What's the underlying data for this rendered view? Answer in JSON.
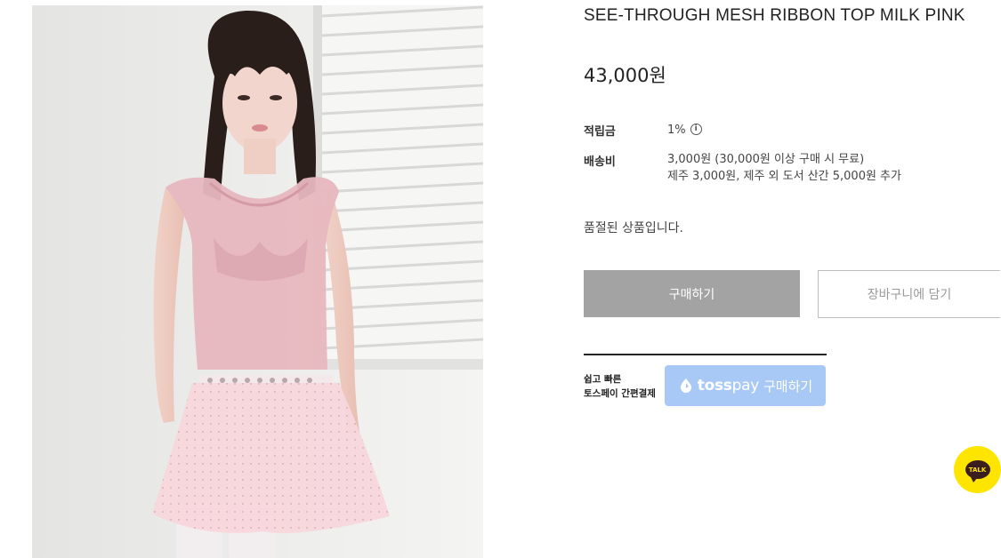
{
  "product": {
    "title": "SEE-THROUGH MESH RIBBON TOP MILK PINK",
    "price": "43,000원",
    "image_alt": "model wearing pink mesh top and tulle skirt"
  },
  "info": {
    "points_label": "적립금",
    "points_value": "1%",
    "points_info_glyph": "i",
    "shipping_label": "배송비",
    "shipping_line1": "3,000원 (30,000원 이상 구매 시 무료)",
    "shipping_line2": "제주 3,000원, 제주 외 도서 산간 5,000원 추가"
  },
  "status": {
    "soldout_text": "품절된 상품입니다."
  },
  "buttons": {
    "buy_label": "구매하기",
    "cart_label": "장바구니에 담기"
  },
  "toss": {
    "desc_line1": "쉽고 빠른",
    "desc_line2": "토스페이 간편결제",
    "brand": "toss",
    "pay": "pay",
    "action": "구매하기"
  },
  "talk": {
    "label": "TALK"
  },
  "colors": {
    "buy_bg": "#a3a3a3",
    "toss_bg": "#a8c9f5",
    "talk_bg": "#fee500"
  },
  "icons": [
    "info-icon",
    "toss-logo-icon",
    "kakao-talk-icon"
  ]
}
